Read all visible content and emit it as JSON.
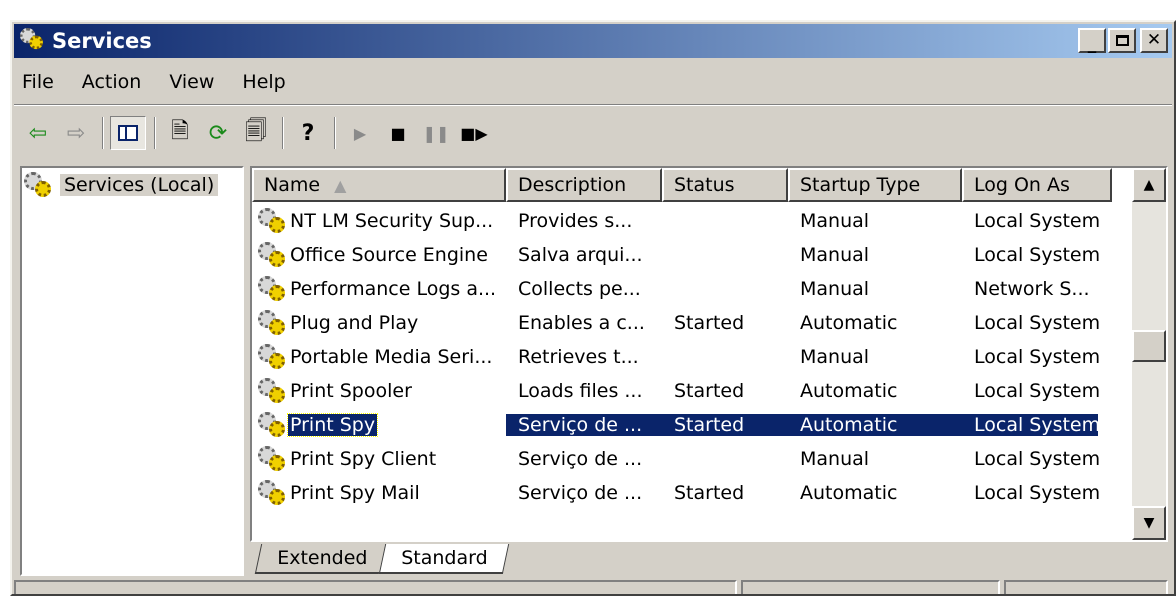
{
  "window": {
    "title": "Services"
  },
  "menu": [
    "File",
    "Action",
    "View",
    "Help"
  ],
  "tree": {
    "root": "Services (Local)"
  },
  "columns": [
    "Name",
    "Description",
    "Status",
    "Startup Type",
    "Log On As"
  ],
  "rows": [
    {
      "name": "NT LM Security Sup...",
      "description": "Provides s...",
      "status": "",
      "startup": "Manual",
      "logon": "Local System",
      "selected": false
    },
    {
      "name": "Office Source Engine",
      "description": "Salva arqui...",
      "status": "",
      "startup": "Manual",
      "logon": "Local System",
      "selected": false
    },
    {
      "name": "Performance Logs a...",
      "description": "Collects pe...",
      "status": "",
      "startup": "Manual",
      "logon": "Network S...",
      "selected": false
    },
    {
      "name": "Plug and Play",
      "description": "Enables a c...",
      "status": "Started",
      "startup": "Automatic",
      "logon": "Local System",
      "selected": false
    },
    {
      "name": "Portable Media Seri...",
      "description": "Retrieves t...",
      "status": "",
      "startup": "Manual",
      "logon": "Local System",
      "selected": false
    },
    {
      "name": "Print Spooler",
      "description": "Loads files ...",
      "status": "Started",
      "startup": "Automatic",
      "logon": "Local System",
      "selected": false
    },
    {
      "name": "Print Spy",
      "description": "Serviço de ...",
      "status": "Started",
      "startup": "Automatic",
      "logon": "Local System",
      "selected": true
    },
    {
      "name": "Print Spy Client",
      "description": "Serviço de ...",
      "status": "",
      "startup": "Manual",
      "logon": "Local System",
      "selected": false
    },
    {
      "name": "Print Spy Mail",
      "description": "Serviço de ...",
      "status": "Started",
      "startup": "Automatic",
      "logon": "Local System",
      "selected": false
    }
  ],
  "tabs": [
    "Extended",
    "Standard"
  ],
  "active_tab": "Standard",
  "colors": {
    "titlebar_start": "#0a246a",
    "titlebar_end": "#a6caf0",
    "selection": "#0a246a",
    "chrome": "#d4d0c8"
  }
}
